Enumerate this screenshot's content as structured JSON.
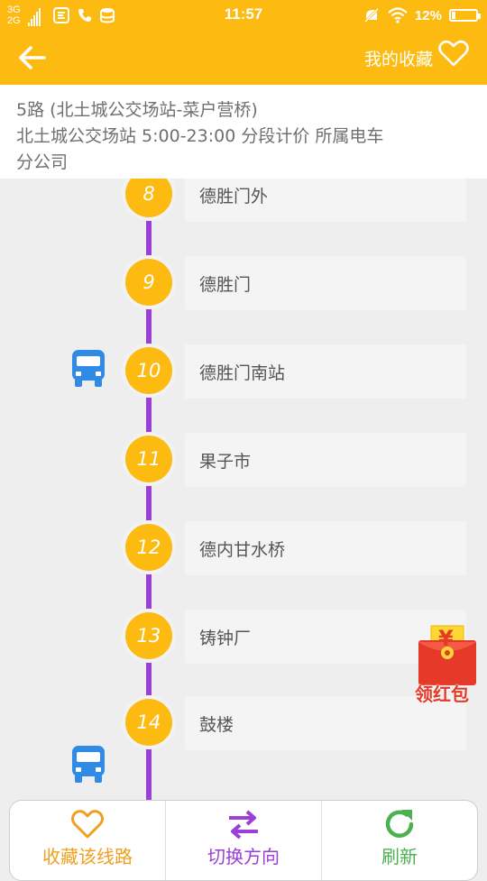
{
  "status_bar": {
    "network": [
      "3G",
      "2G"
    ],
    "time": "11:57",
    "battery": "12%",
    "icons": [
      "signal-icon",
      "app-notification-icon",
      "phone-icon",
      "storage-icon",
      "mute-icon",
      "wifi-icon",
      "battery-icon"
    ]
  },
  "header": {
    "back_icon": "arrow-left-icon",
    "favorites_label": "我的收藏",
    "favorites_icon": "heart-outline-icon"
  },
  "route_info": {
    "line1": "5路 (北土城公交场站-菜户营桥)",
    "line2": "北土城公交场站 5:00-23:00 分段计价 所属电车",
    "line3": "分公司"
  },
  "stops": [
    {
      "number": "8",
      "name": "德胜门外"
    },
    {
      "number": "9",
      "name": "德胜门"
    },
    {
      "number": "10",
      "name": "德胜门南站"
    },
    {
      "number": "11",
      "name": "果子市"
    },
    {
      "number": "12",
      "name": "德内甘水桥"
    },
    {
      "number": "13",
      "name": "铸钟厂"
    },
    {
      "number": "14",
      "name": "鼓楼"
    }
  ],
  "buses": [
    {
      "icon": "bus-icon",
      "at_stop": "10"
    },
    {
      "icon": "bus-icon",
      "between_stops": [
        "14",
        "15"
      ]
    }
  ],
  "red_packet": {
    "symbol": "¥",
    "label": "领红包"
  },
  "bottom_bar": {
    "favorite_line": {
      "label": "收藏该线路",
      "icon": "heart-outline-icon"
    },
    "switch_direction": {
      "label": "切换方向",
      "icon": "swap-arrows-icon"
    },
    "refresh": {
      "label": "刷新",
      "icon": "refresh-icon"
    }
  },
  "colors": {
    "accent": "#fdbb12",
    "route_line": "#9b3fd6",
    "bus": "#2f8be6",
    "favorite": "#f0a020",
    "switch": "#9b3fd6",
    "refresh": "#4caf50",
    "red_packet": "#e53a2a"
  }
}
